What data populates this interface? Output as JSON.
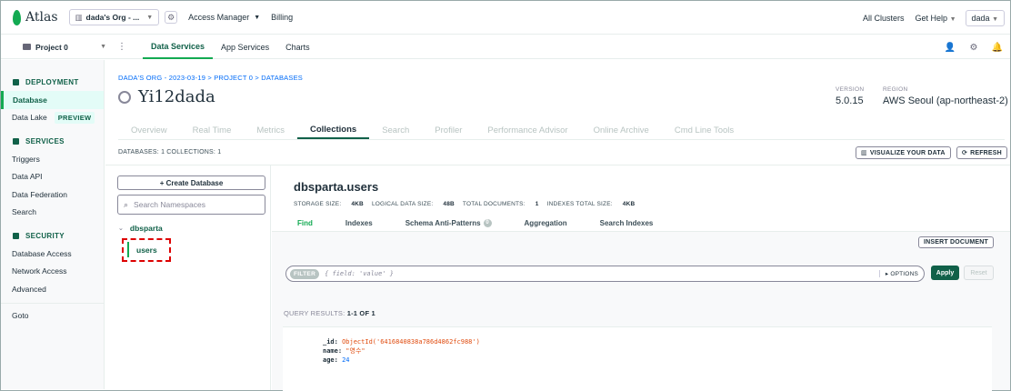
{
  "topbar": {
    "logo_text": "Atlas",
    "org_selector": "dada's Org - ...",
    "access_manager": "Access Manager",
    "billing": "Billing",
    "all_clusters": "All Clusters",
    "get_help": "Get Help",
    "user": "dada"
  },
  "projectbar": {
    "project": "Project 0",
    "tabs": [
      {
        "label": "Data Services",
        "active": true
      },
      {
        "label": "App Services",
        "active": false
      },
      {
        "label": "Charts",
        "active": false
      }
    ]
  },
  "sidebar": {
    "deployment": {
      "heading": "DEPLOYMENT",
      "items": [
        {
          "label": "Database",
          "active": true
        },
        {
          "label": "Data Lake",
          "badge": "PREVIEW"
        }
      ]
    },
    "services": {
      "heading": "SERVICES",
      "items": [
        "Triggers",
        "Data API",
        "Data Federation",
        "Search"
      ]
    },
    "security": {
      "heading": "SECURITY",
      "items": [
        "Database Access",
        "Network Access",
        "Advanced"
      ]
    },
    "goto": "Goto"
  },
  "cluster": {
    "breadcrumb": "DADA'S ORG - 2023-03-19 > PROJECT 0 > DATABASES",
    "name": "Yi12dada",
    "version_label": "VERSION",
    "version": "5.0.15",
    "region_label": "REGION",
    "region": "AWS Seoul (ap-northeast-2)"
  },
  "cluster_tabs": [
    "Overview",
    "Real Time",
    "Metrics",
    "Collections",
    "Search",
    "Profiler",
    "Performance Advisor",
    "Online Archive",
    "Cmd Line Tools"
  ],
  "counts": "DATABASES: 1   COLLECTIONS: 1",
  "actions": {
    "visualize": "VISUALIZE YOUR DATA",
    "refresh": "REFRESH"
  },
  "namespaces": {
    "create_database": "+ Create Database",
    "search_placeholder": "Search Namespaces",
    "database": "dbsparta",
    "collection": "users"
  },
  "collection": {
    "title": "dbsparta.users",
    "stats": {
      "storage_label": "STORAGE SIZE:",
      "storage": "4KB",
      "logical_label": "LOGICAL DATA SIZE:",
      "logical": "48B",
      "docs_label": "TOTAL DOCUMENTS:",
      "docs": "1",
      "indexes_label": "INDEXES TOTAL SIZE:",
      "indexes": "4KB"
    },
    "tabs": [
      "Find",
      "Indexes",
      "Schema Anti-Patterns",
      "Aggregation",
      "Search Indexes"
    ],
    "schema_badge": "0",
    "insert_document": "INSERT DOCUMENT",
    "filter_tag": "FILTER",
    "filter_placeholder": "{ field: 'value' }",
    "options": "▸ OPTIONS",
    "apply": "Apply",
    "reset": "Reset",
    "query_results_label": "QUERY RESULTS:",
    "query_results": "1-1 OF 1",
    "document": {
      "id_key": "_id:",
      "id_value": "ObjectId('6416840838a786d4862fc988')",
      "name_key": "name:",
      "name_value": "\"영수\"",
      "age_key": "age:",
      "age_value": "24"
    }
  }
}
